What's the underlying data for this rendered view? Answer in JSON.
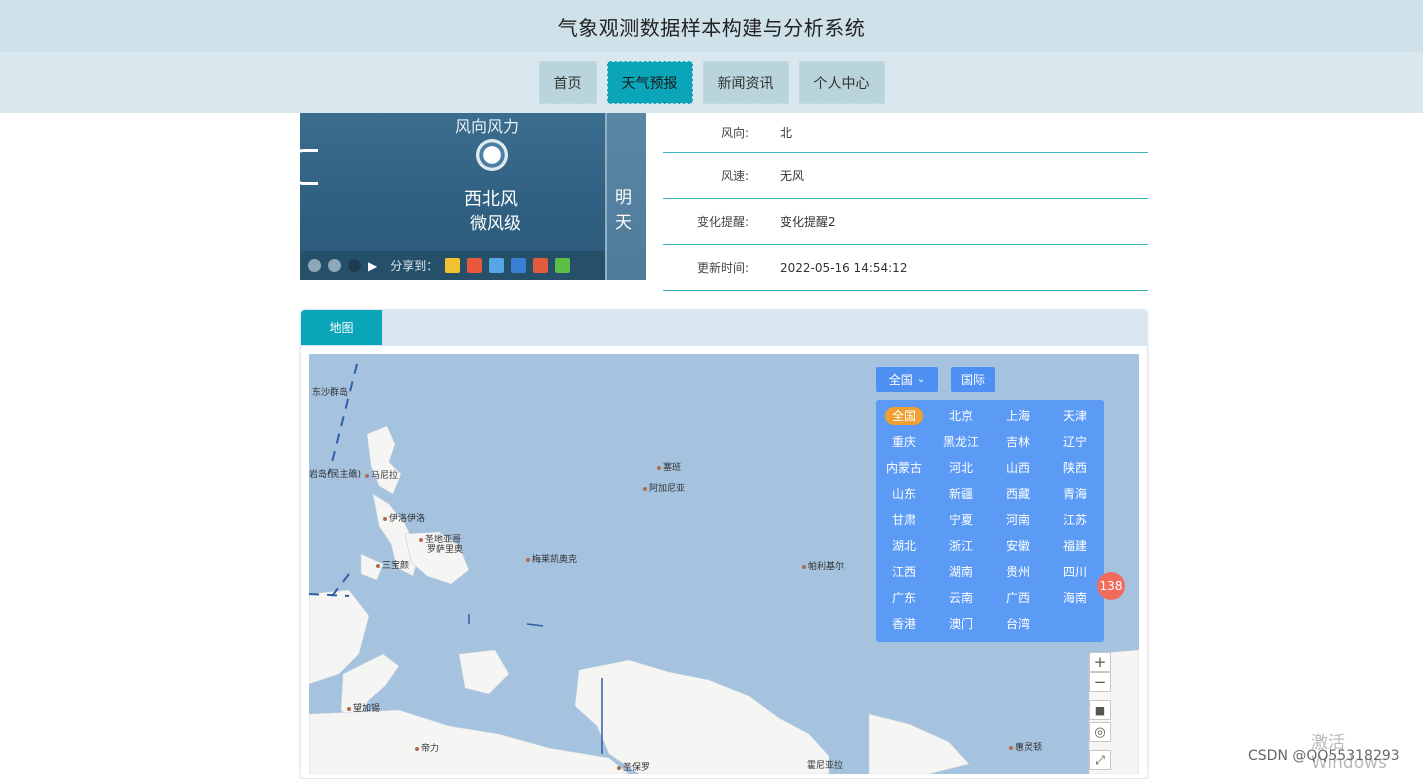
{
  "header": {
    "title": "气象观测数据样本构建与分析系统"
  },
  "nav": {
    "items": [
      "首页",
      "天气预报",
      "新闻资讯",
      "个人中心"
    ],
    "active_index": 1
  },
  "weather_image": {
    "wind_label": "风向风力",
    "wind_dir_text": "西北风",
    "wind_level_text": "微风级",
    "tomorrow_text": "明天",
    "share_label": "分享到："
  },
  "info": {
    "rows": [
      {
        "label": "风向:",
        "value": "北"
      },
      {
        "label": "风速:",
        "value": "无风"
      },
      {
        "label": "变化提醒:",
        "value": "变化提醒2"
      },
      {
        "label": "更新时间:",
        "value": "2022-05-16 14:54:12"
      }
    ]
  },
  "map_panel": {
    "tab_label": "地图",
    "region_button": "全国",
    "intl_button": "国际",
    "provinces": [
      "全国",
      "北京",
      "上海",
      "天津",
      "重庆",
      "黑龙江",
      "吉林",
      "辽宁",
      "内蒙古",
      "河北",
      "山西",
      "陕西",
      "山东",
      "新疆",
      "西藏",
      "青海",
      "甘肃",
      "宁夏",
      "河南",
      "江苏",
      "湖北",
      "浙江",
      "安徽",
      "福建",
      "江西",
      "湖南",
      "贵州",
      "四川",
      "广东",
      "云南",
      "广西",
      "海南",
      "香港",
      "澳门",
      "台湾"
    ],
    "selected_province": "全国",
    "badge_count": "138",
    "places": [
      "东沙群岛",
      "岩岛(民主礁)",
      "马尼拉",
      "伊洛伊洛",
      "圣地亚哥",
      "罗萨里奥",
      "三宝颜",
      "塞班",
      "阿加尼亚",
      "梅莱凯奥克",
      "帕利基尔",
      "望加锡",
      "帝力",
      "圣保罗",
      "霍尼亚拉",
      "惠灵顿"
    ]
  },
  "os": {
    "watermark": "激活 Windows",
    "csdn": "CSDN @QQ55318293"
  },
  "colors": {
    "accent": "#0aa5b9",
    "map_water": "#a5c2df",
    "map_land": "#f5f6f4",
    "dropdown": "#5b9af5",
    "badge": "#f26b5d"
  }
}
